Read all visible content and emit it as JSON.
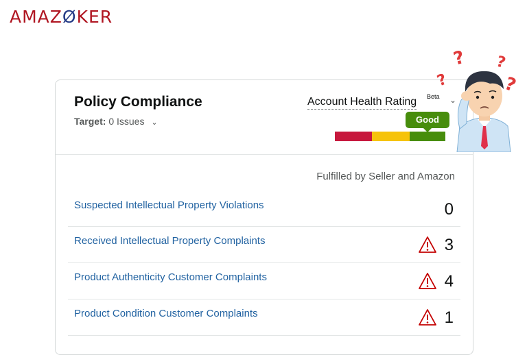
{
  "logo": {
    "part1": "AMA",
    "part2": "Z",
    "part3": "Ø",
    "part4": "KER"
  },
  "card": {
    "title": "Policy Compliance",
    "target_label": "Target:",
    "target_value": "0 Issues",
    "account_health_label": "Account Health Rating",
    "beta": "Beta",
    "rating": "Good",
    "scale_colors": [
      "#c7183d",
      "#f6c30b",
      "#478d0c"
    ],
    "fulfilled": "Fulfilled by Seller and Amazon",
    "rows": [
      {
        "label": "Suspected Intellectual Property Violations",
        "count": "0",
        "warning": false
      },
      {
        "label": "Received Intellectual Property Complaints",
        "count": "3",
        "warning": true
      },
      {
        "label": "Product Authenticity Customer Complaints",
        "count": "4",
        "warning": true
      },
      {
        "label": "Product Condition Customer Complaints",
        "count": "1",
        "warning": true
      }
    ]
  },
  "icons": {
    "warning": "warning-triangle-icon",
    "chevron": "chevron-down-icon"
  }
}
